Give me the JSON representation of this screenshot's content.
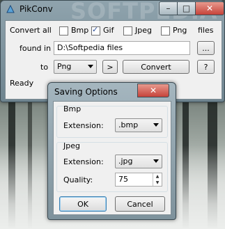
{
  "main_window": {
    "title": "PikConv",
    "watermark": "SOFTPEDIA",
    "caption_buttons": {
      "minimize": "–",
      "maximize": "□",
      "close": "✕"
    },
    "convert_all_label": "Convert all",
    "formats": [
      {
        "label": "Bmp",
        "checked": false
      },
      {
        "label": "Gif",
        "checked": true
      },
      {
        "label": "Jpeg",
        "checked": false
      },
      {
        "label": "Png",
        "checked": false
      }
    ],
    "files_label": "files",
    "found_in_label": "found in",
    "folder_value": "D:\\Softpedia files",
    "browse_label": "...",
    "to_label": "to",
    "target_format": "Png",
    "arrow_button": ">",
    "convert_label": "Convert",
    "help_label": "?",
    "status": "Ready"
  },
  "dialog": {
    "title": "Saving Options",
    "close": "✕",
    "bmp_group": {
      "title": "Bmp",
      "extension_label": "Extension:",
      "extension_value": ".bmp"
    },
    "jpeg_group": {
      "title": "Jpeg",
      "extension_label": "Extension:",
      "extension_value": ".jpg",
      "quality_label": "Quality:",
      "quality_value": "75"
    },
    "ok_label": "OK",
    "cancel_label": "Cancel"
  }
}
